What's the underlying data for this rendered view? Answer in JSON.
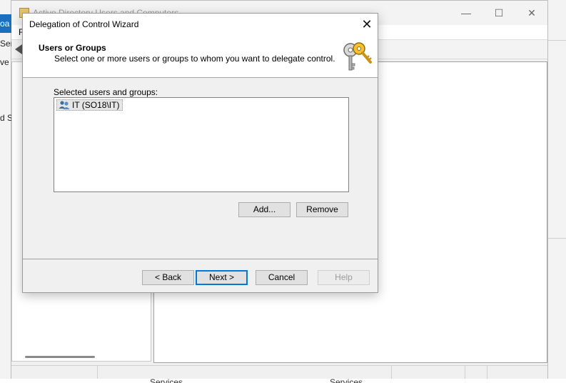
{
  "background_window": {
    "title": "Active Directory Users and Computers",
    "menu_first": "F",
    "controls": {
      "minimize": "—",
      "maximize": "☐",
      "close": "✕"
    },
    "edge_fragments": [
      "oa",
      "Ser",
      "ve",
      "d S"
    ],
    "bottom_labels": [
      "Services",
      "Services"
    ]
  },
  "dialog": {
    "title": "Delegation of Control Wizard",
    "close_glyph": "✕",
    "header": {
      "title": "Users or Groups",
      "subtitle": "Select one or more users or groups to whom you want to delegate control."
    },
    "list_label": "Selected users and groups:",
    "items": [
      {
        "label": "IT (SO18\\IT)"
      }
    ],
    "buttons": {
      "add": "Add...",
      "remove": "Remove",
      "back": "< Back",
      "next": "Next >",
      "cancel": "Cancel",
      "help": "Help"
    }
  }
}
